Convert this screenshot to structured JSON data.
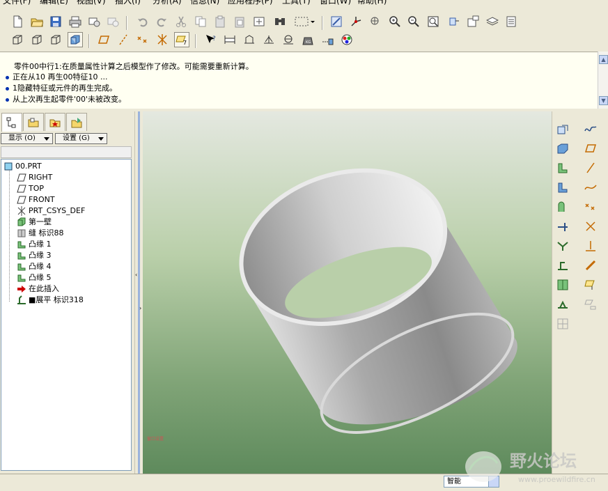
{
  "menu": [
    "文件(F)",
    "编辑(E)",
    "视图(V)",
    "插入(I)",
    "分析(A)",
    "信息(N)",
    "应用程序(P)",
    "工具(T)",
    "窗口(W)",
    "帮助(H)"
  ],
  "messages": [
    {
      "text": "零件00中行1:在质量属性计算之后模型作了修改。可能需要重新计算。",
      "bullet": false
    },
    {
      "text": "正在从10 再生00特征10 ...",
      "bullet": true
    },
    {
      "text": "1隐藏特征或元件的再生完成。",
      "bullet": true
    },
    {
      "text": "从上次再生起零件'00'未被改变。",
      "bullet": true
    }
  ],
  "nav": {
    "show_label": "显示 (O)",
    "settings_label": "设置 (G)"
  },
  "tree": {
    "root": "00.PRT",
    "items": [
      "RIGHT",
      "TOP",
      "FRONT",
      "PRT_CSYS_DEF",
      "第一壁",
      "缝 标识88",
      "凸缘 1",
      "凸缘 3",
      "凸缘 4",
      "凸缘 5",
      "在此插入",
      "展平 标识318"
    ]
  },
  "status": {
    "filter_value": "智能"
  },
  "watermark": {
    "title": "野火论坛",
    "url": "www.proewildfire.cn"
  },
  "viewport": {
    "small_label": "窗口设置"
  },
  "colors": {
    "accent": "#0030b0",
    "bg_top": "#e4e8e0",
    "bg_bottom": "#5e8a5c"
  }
}
